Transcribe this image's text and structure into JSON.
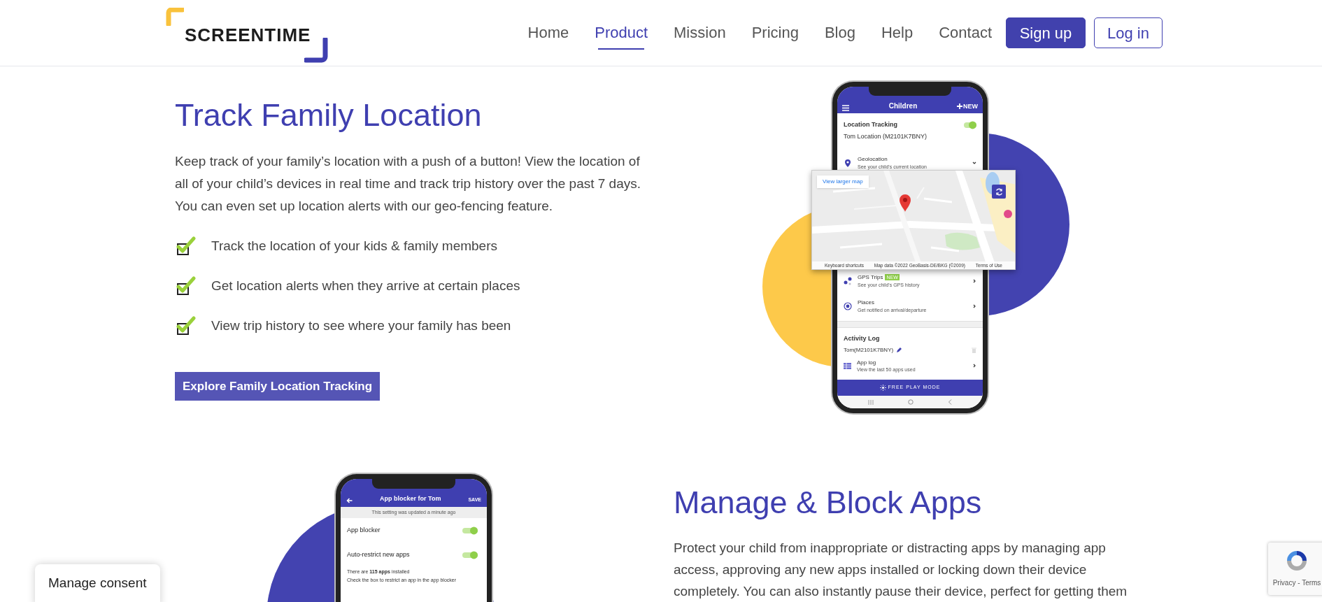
{
  "header": {
    "logo": "SCREENTIME",
    "nav": [
      {
        "label": "Home",
        "selected": false
      },
      {
        "label": "Product",
        "selected": true
      },
      {
        "label": "Mission",
        "selected": false
      },
      {
        "label": "Pricing",
        "selected": false
      },
      {
        "label": "Blog",
        "selected": false
      },
      {
        "label": "Help",
        "selected": false
      },
      {
        "label": "Contact",
        "selected": false
      }
    ],
    "buttons": [
      {
        "label": "Sign up",
        "kind": "primary"
      },
      {
        "label": "Log in",
        "kind": "outline"
      }
    ]
  },
  "location_section": {
    "title": "Track Family Location",
    "body": "Keep track of your family’s location with a push of a button! View the location of all of your child’s devices in real time and track trip history over the past 7 days. You can even set up location alerts with our geo-fencing feature.",
    "features": [
      {
        "text": "Track the location of your kids & family members",
        "checked": true
      },
      {
        "text": "Get location alerts when they arrive at certain places",
        "checked": true
      },
      {
        "text": "View trip history to see where your family has been",
        "checked": true
      }
    ],
    "button": "Explore Family Location Tracking",
    "phone": {
      "title": "Children",
      "action": "NEW",
      "tracking": {
        "label": "Location Tracking",
        "device": "Tom Location (M2101K7BNY)",
        "on": true
      },
      "rows": [
        {
          "kind": "geolocation",
          "title": "Geolocation",
          "subtitle": "See your child's current location"
        },
        {
          "kind": "trips",
          "title": "GPS Trips",
          "badge": "NEW",
          "subtitle": "See your child's GPS history"
        },
        {
          "kind": "places",
          "title": "Places",
          "subtitle": "Get notified on arrival/departure"
        }
      ],
      "map": {
        "button": "View larger map",
        "footer": [
          "Keyboard shortcuts",
          "Map data ©2022 GeoBasis-DE/BKG (©2009)",
          "Terms of Use"
        ]
      },
      "activity": {
        "title": "Activity Log",
        "device": "Tom(M2101K7BNY)"
      },
      "app_log": {
        "title": "App log",
        "subtitle": "View the last 50 apps used"
      },
      "bottom_bar": "FREE PLAY MODE"
    }
  },
  "apps_section": {
    "title": "Manage & Block Apps",
    "body": "Protect your child from inappropriate or distracting apps by managing app access, approving any new apps installed or locking down their device completely. You can also instantly pause their device, perfect for getting them",
    "phone": {
      "title": "App blocker for Tom",
      "action": "SAVE",
      "notice": "This setting was updated a minute ago",
      "toggles": [
        {
          "label": "App blocker",
          "on": true
        },
        {
          "label": "Auto-restrict new apps",
          "on": true
        }
      ],
      "info": [
        "There are **115 apps** installed",
        "Check the box to restrict an app in the app blocker"
      ]
    }
  },
  "consent": "Manage consent",
  "recaptcha": "Privacy - Terms"
}
